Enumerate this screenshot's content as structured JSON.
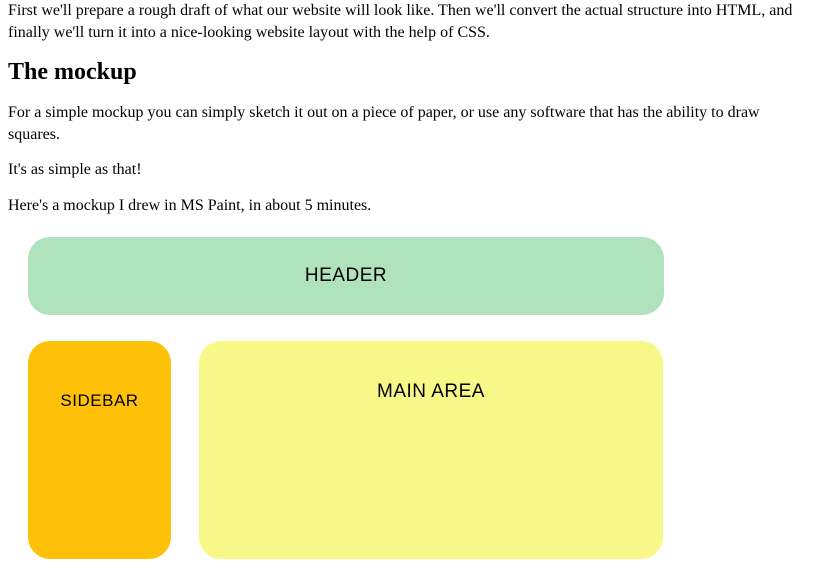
{
  "intro": "First we'll prepare a rough draft of what our website will look like. Then we'll convert the actual structure into HTML, and finally we'll turn it into a nice-looking website layout with the help of CSS.",
  "heading": "The mockup",
  "paragraphs": {
    "p1": "For a simple mockup you can simply sketch it out on a piece of paper, or use any software that has the ability to draw squares.",
    "p2": "It's as simple as that!",
    "p3": "Here's a mockup I drew in MS Paint, in about 5 minutes."
  },
  "mockup": {
    "header_label": "HEADER",
    "sidebar_label": "SIDEBAR",
    "main_label": "MAIN AREA"
  }
}
